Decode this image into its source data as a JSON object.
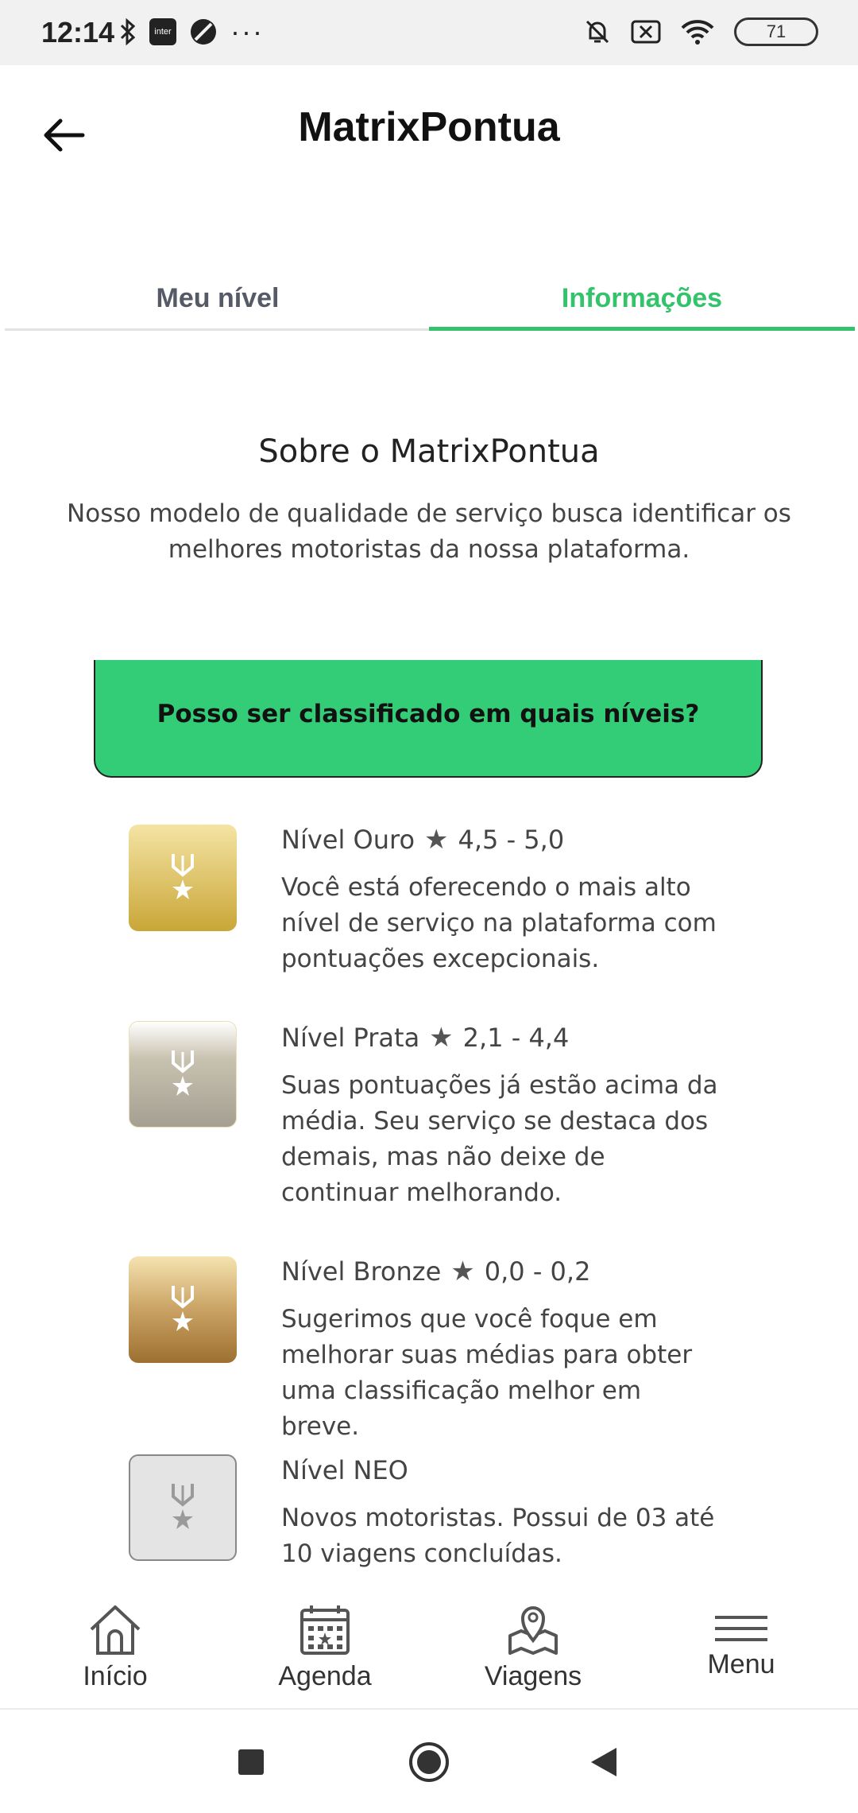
{
  "status_bar": {
    "time": "12:14",
    "inter_label": "inter",
    "more": "···",
    "battery": "71"
  },
  "header": {
    "title": "MatrixPontua"
  },
  "tabs": [
    {
      "label": "Meu nível",
      "active": false
    },
    {
      "label": "Informações",
      "active": true
    }
  ],
  "intro": {
    "title": "Sobre o MatrixPontua",
    "text": "Nosso modelo de qualidade de serviço busca identificar os melhores motoristas da nossa plataforma."
  },
  "levels_box": {
    "label": "Posso ser classificado em quais níveis?"
  },
  "levels": [
    {
      "name": "Nível Ouro",
      "range": "4,5 - 5,0",
      "description": "Você está oferecendo o mais alto nível de serviço na plataforma com pontuações excepcionais."
    },
    {
      "name": "Nível Prata",
      "range": "2,1 - 4,4",
      "description": "Suas pontuações já estão acima da média. Seu serviço se destaca dos demais, mas não deixe de continuar melhorando."
    },
    {
      "name": "Nível Bronze",
      "range": "0,0 - 0,2",
      "description": "Sugerimos que você foque em melhorar suas médias para obter uma classificação melhor em breve."
    },
    {
      "name": "Nível NEO",
      "range": "",
      "description": "Novos motoristas. Possui de 03 até 10 viagens concluídas."
    }
  ],
  "bottom_nav": [
    {
      "label": "Início",
      "icon": "home-icon"
    },
    {
      "label": "Agenda",
      "icon": "calendar-icon"
    },
    {
      "label": "Viagens",
      "icon": "map-pin-icon"
    },
    {
      "label": "Menu",
      "icon": "menu-icon"
    }
  ],
  "colors": {
    "accent": "#33c36b",
    "box": "#33cc77"
  }
}
